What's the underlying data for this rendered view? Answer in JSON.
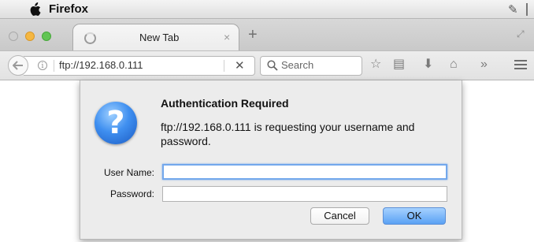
{
  "menubar": {
    "app_name": "Firefox"
  },
  "tabs": [
    {
      "label": "New Tab"
    }
  ],
  "navbar": {
    "url": "ftp://192.168.0.111",
    "search_placeholder": "Search",
    "overflow": "»"
  },
  "dialog": {
    "title": "Authentication Required",
    "message": "ftp://192.168.0.111 is requesting your username and password.",
    "icon_glyph": "?",
    "username_label": "User Name:",
    "username_value": "",
    "password_label": "Password:",
    "password_value": "",
    "cancel_label": "Cancel",
    "ok_label": "OK"
  },
  "colors": {
    "ok_button": "#5aa1f4",
    "focus_ring": "#73a8ec"
  }
}
